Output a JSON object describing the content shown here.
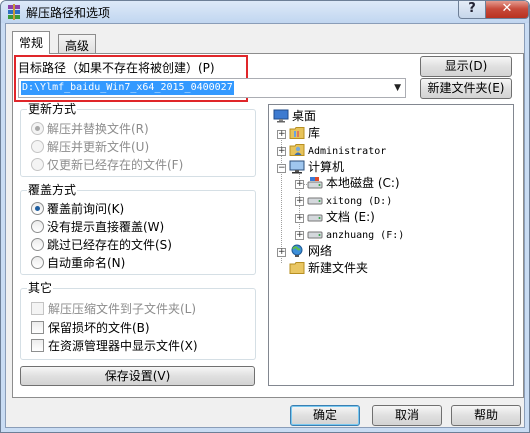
{
  "window": {
    "title": "解压路径和选项"
  },
  "tabs": [
    {
      "label": "常规"
    },
    {
      "label": "高级"
    }
  ],
  "destination": {
    "label": "目标路径（如果不存在将被创建）(P)",
    "value": "D:\\Ylmf_baidu_Win7_x64_2015_0400027",
    "show_button": "显示(D)",
    "new_folder_button": "新建文件夹(E)"
  },
  "update_mode": {
    "title": "更新方式",
    "options": [
      {
        "label": "解压并替换文件(R)",
        "checked": true,
        "disabled": true
      },
      {
        "label": "解压并更新文件(U)",
        "checked": false,
        "disabled": true
      },
      {
        "label": "仅更新已经存在的文件(F)",
        "checked": false,
        "disabled": true
      }
    ]
  },
  "overwrite_mode": {
    "title": "覆盖方式",
    "options": [
      {
        "label": "覆盖前询问(K)",
        "checked": true
      },
      {
        "label": "没有提示直接覆盖(W)",
        "checked": false
      },
      {
        "label": "跳过已经存在的文件(S)",
        "checked": false
      },
      {
        "label": "自动重命名(N)",
        "checked": false
      }
    ]
  },
  "misc": {
    "title": "其它",
    "options": [
      {
        "label": "解压压缩文件到子文件夹(L)",
        "disabled": true
      },
      {
        "label": "保留损坏的文件(B)",
        "disabled": false
      },
      {
        "label": "在资源管理器中显示文件(X)",
        "disabled": false
      }
    ],
    "save_button": "保存设置(V)"
  },
  "tree": {
    "root": "桌面",
    "items": [
      {
        "label": "库",
        "icon": "library-icon"
      },
      {
        "label": "Administrator",
        "icon": "user-folder-icon"
      },
      {
        "label": "计算机",
        "icon": "computer-icon"
      },
      {
        "label": "本地磁盘 (C:)",
        "icon": "system-drive-icon"
      },
      {
        "label": "xitong (D:)",
        "icon": "drive-icon"
      },
      {
        "label": "文档 (E:)",
        "icon": "drive-icon"
      },
      {
        "label": "anzhuang (F:)",
        "icon": "drive-icon"
      },
      {
        "label": "网络",
        "icon": "network-icon"
      },
      {
        "label": "新建文件夹",
        "icon": "folder-icon"
      }
    ]
  },
  "footer": {
    "ok": "确定",
    "cancel": "取消",
    "help": "帮助"
  },
  "colors": {
    "accent": "#e0262a",
    "selection": "#3399ff"
  }
}
